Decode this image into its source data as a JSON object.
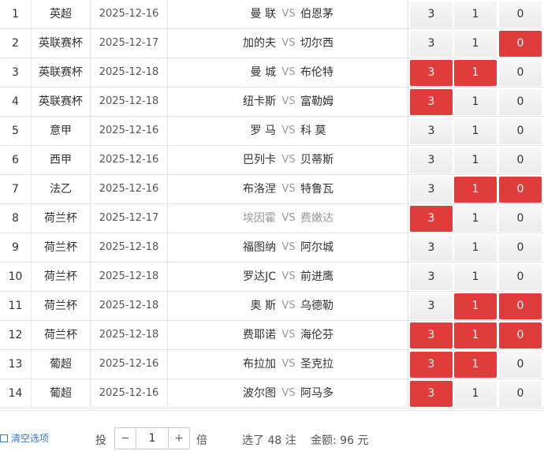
{
  "vs_label": "VS",
  "matches": [
    {
      "no": "1",
      "league": "英超",
      "date": "2025-12-16",
      "home": "曼 联",
      "away": "伯恩茅",
      "home_dim": false,
      "o3": "3",
      "o1": "1",
      "o0": "0",
      "sel3": false,
      "sel1": false,
      "sel0": false
    },
    {
      "no": "2",
      "league": "英联赛杯",
      "date": "2025-12-17",
      "home": "加的夫",
      "away": "切尔西",
      "home_dim": false,
      "o3": "3",
      "o1": "1",
      "o0": "0",
      "sel3": false,
      "sel1": false,
      "sel0": true
    },
    {
      "no": "3",
      "league": "英联赛杯",
      "date": "2025-12-18",
      "home": "曼 城",
      "away": "布伦特",
      "home_dim": false,
      "o3": "3",
      "o1": "1",
      "o0": "0",
      "sel3": true,
      "sel1": true,
      "sel0": false
    },
    {
      "no": "4",
      "league": "英联赛杯",
      "date": "2025-12-18",
      "home": "纽卡斯",
      "away": "富勒姆",
      "home_dim": false,
      "o3": "3",
      "o1": "1",
      "o0": "0",
      "sel3": true,
      "sel1": false,
      "sel0": false
    },
    {
      "no": "5",
      "league": "意甲",
      "date": "2025-12-16",
      "home": "罗 马",
      "away": "科 莫",
      "home_dim": false,
      "o3": "3",
      "o1": "1",
      "o0": "0",
      "sel3": false,
      "sel1": false,
      "sel0": false
    },
    {
      "no": "6",
      "league": "西甲",
      "date": "2025-12-16",
      "home": "巴列卡",
      "away": "贝蒂斯",
      "home_dim": false,
      "o3": "3",
      "o1": "1",
      "o0": "0",
      "sel3": false,
      "sel1": false,
      "sel0": false
    },
    {
      "no": "7",
      "league": "法乙",
      "date": "2025-12-16",
      "home": "布洛涅",
      "away": "特鲁瓦",
      "home_dim": false,
      "o3": "3",
      "o1": "1",
      "o0": "0",
      "sel3": false,
      "sel1": true,
      "sel0": true
    },
    {
      "no": "8",
      "league": "荷兰杯",
      "date": "2025-12-17",
      "home": "埃因霍",
      "away": "费嫩达",
      "home_dim": true,
      "o3": "3",
      "o1": "1",
      "o0": "0",
      "sel3": true,
      "sel1": false,
      "sel0": false
    },
    {
      "no": "9",
      "league": "荷兰杯",
      "date": "2025-12-18",
      "home": "福图纳",
      "away": "阿尔城",
      "home_dim": false,
      "o3": "3",
      "o1": "1",
      "o0": "0",
      "sel3": false,
      "sel1": false,
      "sel0": false
    },
    {
      "no": "10",
      "league": "荷兰杯",
      "date": "2025-12-18",
      "home": "罗达JC",
      "away": "前进鹰",
      "home_dim": false,
      "o3": "3",
      "o1": "1",
      "o0": "0",
      "sel3": false,
      "sel1": false,
      "sel0": false
    },
    {
      "no": "11",
      "league": "荷兰杯",
      "date": "2025-12-18",
      "home": "奥 斯",
      "away": "乌德勒",
      "home_dim": false,
      "o3": "3",
      "o1": "1",
      "o0": "0",
      "sel3": false,
      "sel1": true,
      "sel0": true
    },
    {
      "no": "12",
      "league": "荷兰杯",
      "date": "2025-12-18",
      "home": "费耶诺",
      "away": "海伦芬",
      "home_dim": false,
      "o3": "3",
      "o1": "1",
      "o0": "0",
      "sel3": true,
      "sel1": true,
      "sel0": true
    },
    {
      "no": "13",
      "league": "葡超",
      "date": "2025-12-16",
      "home": "布拉加",
      "away": "圣克拉",
      "home_dim": false,
      "o3": "3",
      "o1": "1",
      "o0": "0",
      "sel3": true,
      "sel1": true,
      "sel0": false
    },
    {
      "no": "14",
      "league": "葡超",
      "date": "2025-12-16",
      "home": "波尔图",
      "away": "阿马多",
      "home_dim": false,
      "o3": "3",
      "o1": "1",
      "o0": "0",
      "sel3": true,
      "sel1": false,
      "sel0": false
    }
  ],
  "footer": {
    "clear_label": "清空选项",
    "bet_label": "投",
    "multiplier": "1",
    "minus_label": "−",
    "plus_label": "+",
    "times_label": "倍",
    "selected_prefix": "选了",
    "selected_count": "48",
    "selected_suffix": "注",
    "amount_label": "金额:",
    "amount_value": "96",
    "amount_unit": "元"
  },
  "colors": {
    "selected": "#e03c3c",
    "link": "#3a7bd5"
  }
}
